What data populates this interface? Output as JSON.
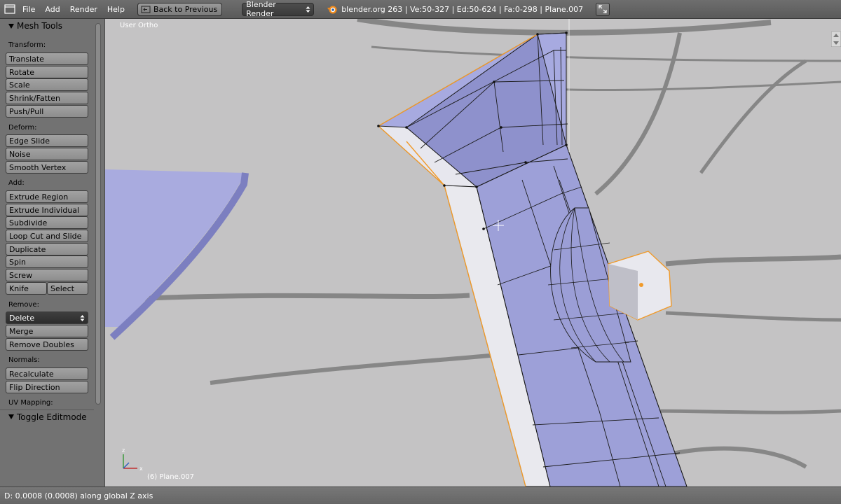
{
  "header": {
    "menus": [
      "File",
      "Add",
      "Render",
      "Help"
    ],
    "back_label": "Back to Previous",
    "render_engine": "Blender Render",
    "stats": "blender.org 263 | Ve:50-327 | Ed:50-624 | Fa:0-298 | Plane.007"
  },
  "toolshelf": {
    "panel_title": "Mesh Tools",
    "sections": {
      "transform": "Transform:",
      "deform": "Deform:",
      "add": "Add:",
      "remove": "Remove:",
      "normals": "Normals:",
      "uv": "UV Mapping:"
    },
    "transform_buttons": [
      "Translate",
      "Rotate",
      "Scale",
      "Shrink/Fatten",
      "Push/Pull"
    ],
    "deform_buttons": [
      "Edge Slide",
      "Noise",
      "Smooth Vertex"
    ],
    "add_buttons": [
      "Extrude Region",
      "Extrude Individual",
      "Subdivide",
      "Loop Cut and Slide",
      "Duplicate",
      "Spin",
      "Screw"
    ],
    "knife": "Knife",
    "select": "Select",
    "delete": "Delete",
    "merge": "Merge",
    "remove_doubles": "Remove Doubles",
    "recalculate": "Recalculate",
    "flip_direction": "Flip Direction",
    "toggle_panel": "Toggle Editmode"
  },
  "viewport": {
    "view_name": "User Ortho",
    "object_label": "(6) Plane.007",
    "axis_z": "z",
    "axis_x": "x"
  },
  "status": {
    "text": "D: 0.0008 (0.0008) along global Z axis"
  },
  "colors": {
    "mesh_face": "#9c9fd6",
    "selection": "#f09a2a",
    "background": "#c4c3c4"
  }
}
